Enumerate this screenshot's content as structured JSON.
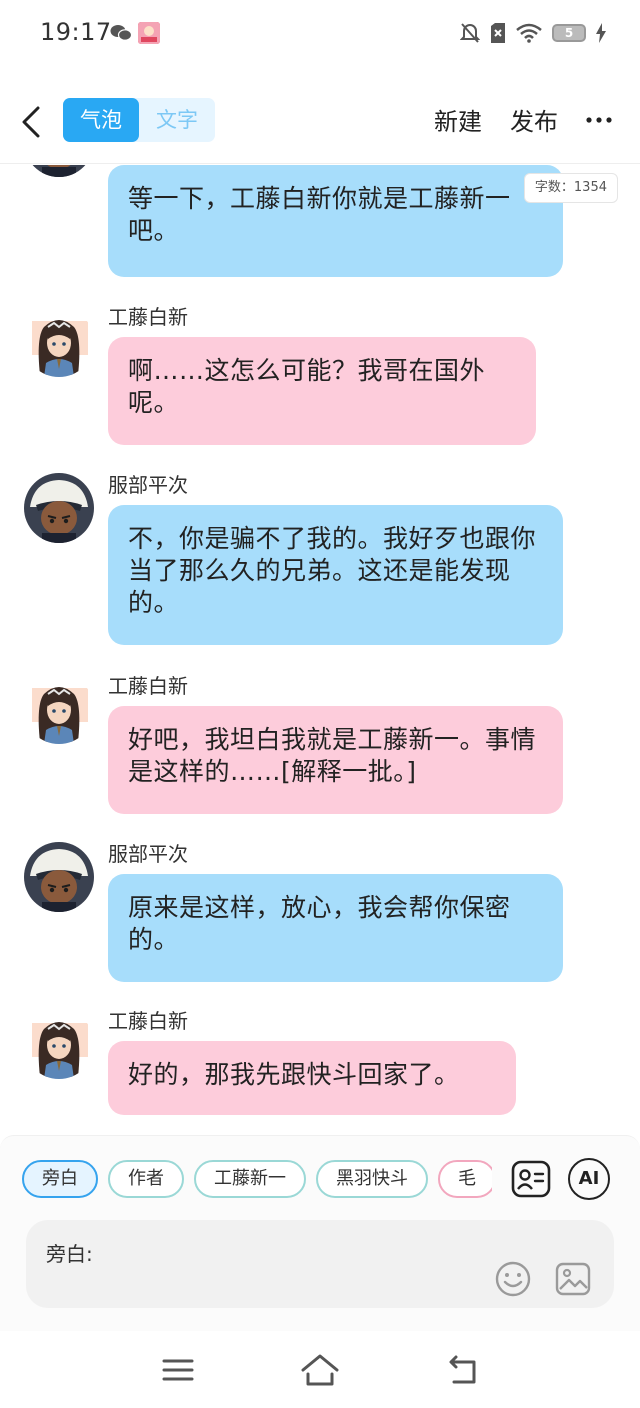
{
  "status_bar": {
    "time": "19:17",
    "battery_level": "5",
    "icons": [
      "wechat-icon",
      "app-notification-icon",
      "mute-icon",
      "no-sim-icon",
      "wifi-icon",
      "battery-icon",
      "charging-icon"
    ]
  },
  "header": {
    "mode_bubble": "气泡",
    "mode_text": "文字",
    "new_label": "新建",
    "publish_label": "发布",
    "more_icon": "more-dots-icon"
  },
  "chat": {
    "word_count": "字数：1354",
    "messages": [
      {
        "sender": "",
        "role": "hattori",
        "text": "等一下，工藤白新你就是工藤新一吧。",
        "color": "#a7ddfb"
      },
      {
        "sender": "工藤白新",
        "role": "kudo",
        "text": "啊……这怎么可能？我哥在国外呢。",
        "color": "#fdccdb"
      },
      {
        "sender": "服部平次",
        "role": "hattori",
        "text": "不，你是骗不了我的。我好歹也跟你当了那么久的兄弟。这还是能发现的。",
        "color": "#a7ddfb"
      },
      {
        "sender": "工藤白新",
        "role": "kudo",
        "text": "好吧，我坦白我就是工藤新一。事情是这样的……[解释一批。]",
        "color": "#fdccdb"
      },
      {
        "sender": "服部平次",
        "role": "hattori",
        "text": "原来是这样，放心，我会帮你保密的。",
        "color": "#a7ddfb"
      },
      {
        "sender": "工藤白新",
        "role": "kudo",
        "text": "好的，那我先跟快斗回家了。",
        "color": "#fdccdb"
      }
    ]
  },
  "composer": {
    "chips": [
      "旁白",
      "作者",
      "工藤新一",
      "黑羽快斗",
      "毛"
    ],
    "selected_chip": "旁白",
    "input_label": "旁白:",
    "ai_label": "AI"
  },
  "colors": {
    "accent": "#29a8f3",
    "blue_bubble": "#a7ddfb",
    "pink_bubble": "#fdccdb"
  }
}
